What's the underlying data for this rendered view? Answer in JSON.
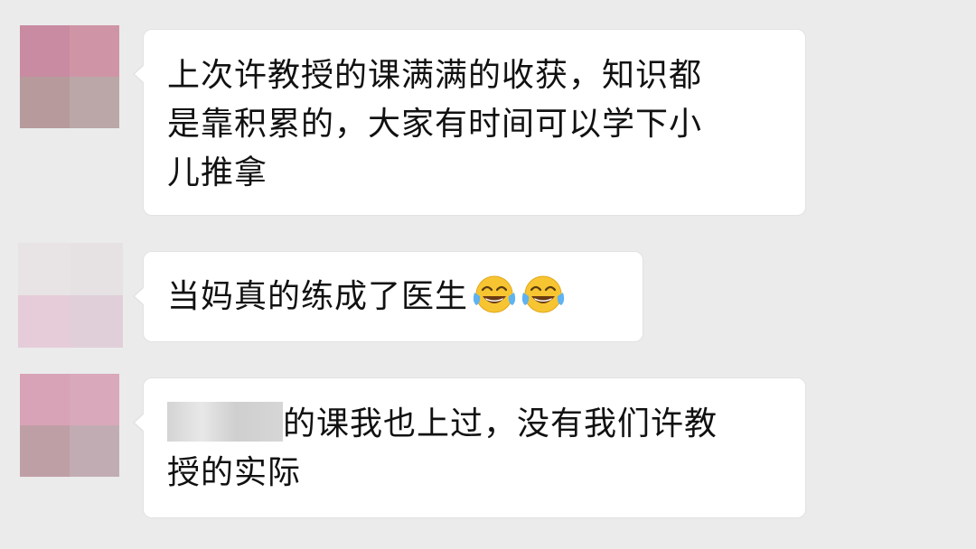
{
  "messages": [
    {
      "avatar": {
        "colors": [
          "#c98ba2",
          "#cf95a6",
          "#b79a9c",
          "#bba7a8"
        ]
      },
      "text": "上次许教授的课满满的收获，知识都\n是靠积累的，大家有时间可以学下小\n儿推拿"
    },
    {
      "avatar": {
        "colors": [
          "#e8e4e6",
          "#e6e2e4",
          "#e5ccd8",
          "#e0cfd9"
        ]
      },
      "text": "当妈真的练成了医生",
      "emojis": [
        "face-with-tears-of-joy-icon",
        "face-with-tears-of-joy-icon"
      ]
    },
    {
      "avatar": {
        "colors": [
          "#d8a3b6",
          "#d9a8ba",
          "#bf9fa6",
          "#c2acb3"
        ]
      },
      "text_line1": "的课我也上过，没有我们许教",
      "text_line2": "授的实际"
    }
  ]
}
